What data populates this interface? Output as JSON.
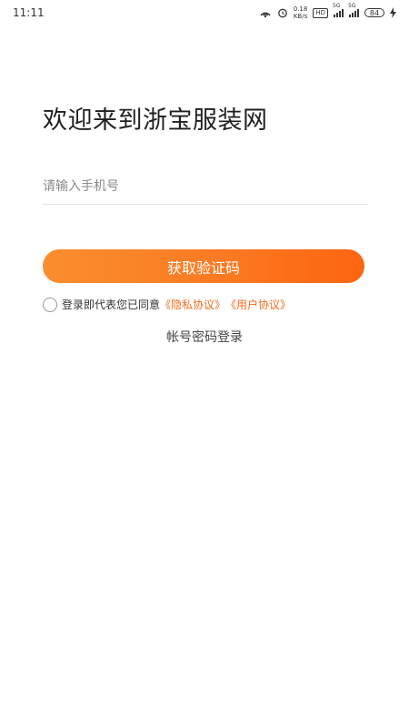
{
  "status_bar": {
    "time": "11:11",
    "net_speed_value": "0.18",
    "net_speed_unit": "KB/s",
    "hd_label": "HD",
    "signal1_label": "5G",
    "signal2_label": "5G",
    "battery": "84"
  },
  "login": {
    "title": "欢迎来到浙宝服装网",
    "phone_placeholder": "请输入手机号",
    "phone_value": "",
    "get_code_label": "获取验证码",
    "agree_text": "登录即代表您已同意",
    "privacy_link": "《隐私协议》",
    "user_agreement_link": "《用户协议》",
    "password_login_label": "帐号密码登录"
  },
  "colors": {
    "accent": "#fb7a22",
    "link": "#f26b1d"
  }
}
